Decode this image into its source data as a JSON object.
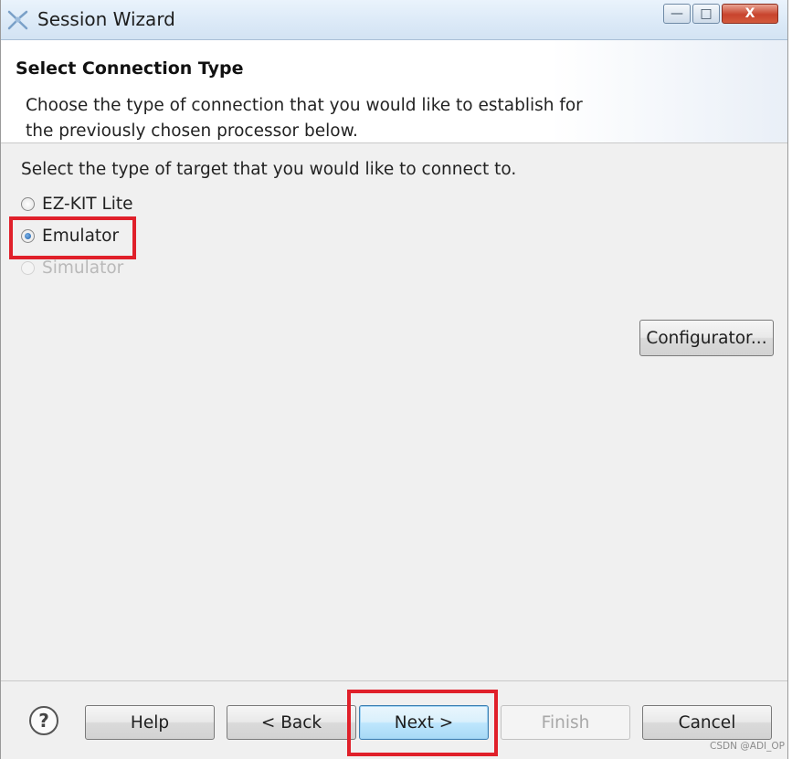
{
  "window": {
    "title": "Session Wizard",
    "minimize_glyph": "—",
    "maximize_glyph": "□",
    "close_glyph": "X"
  },
  "header": {
    "title": "Select Connection Type",
    "description": "Choose the type of connection that you would like to establish for the previously chosen processor below."
  },
  "body": {
    "prompt": "Select the type of target that you would like to connect to.",
    "options": [
      {
        "label": "EZ-KIT Lite",
        "selected": false,
        "enabled": true
      },
      {
        "label": "Emulator",
        "selected": true,
        "enabled": true
      },
      {
        "label": "Simulator",
        "selected": false,
        "enabled": false
      }
    ],
    "configurator_label": "Configurator..."
  },
  "footer": {
    "help_icon_glyph": "?",
    "help_label": "Help",
    "back_label": "< Back",
    "next_label": "Next >",
    "finish_label": "Finish",
    "cancel_label": "Cancel"
  },
  "watermark": "CSDN @ADI_OP",
  "colors": {
    "highlight": "#e0202a",
    "primary_button": "#bee6fd",
    "title_bar": "#dbe9f7"
  }
}
